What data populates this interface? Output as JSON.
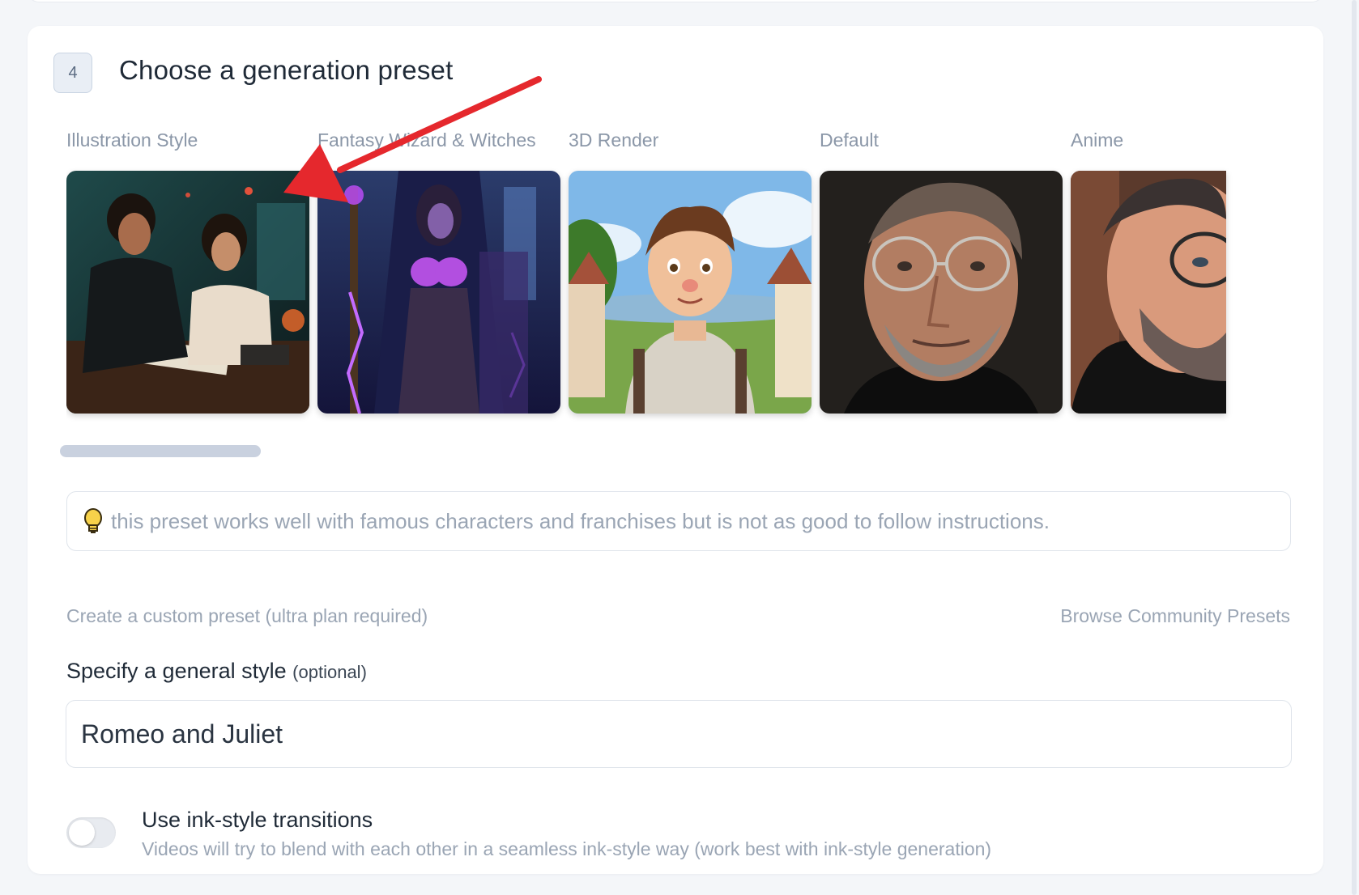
{
  "step": {
    "number": "4",
    "title": "Choose a generation preset"
  },
  "presets": [
    {
      "label": "Illustration Style",
      "image": "two people at a desk in a dark workshop"
    },
    {
      "label": "Fantasy Wizard & Witches",
      "image": "hooded witch with purple glowing staff"
    },
    {
      "label": "3D Render",
      "image": "cartoon 3D boy in hoodie in village"
    },
    {
      "label": "Default",
      "image": "photo portrait of man with round glasses"
    },
    {
      "label": "Anime",
      "image": "painted portrait of man with glasses"
    }
  ],
  "tip": {
    "icon": "lightbulb-icon",
    "text": "this preset works well with famous characters and franchises but is not as good to follow instructions."
  },
  "links": {
    "custom_preset": "Create a custom preset (ultra plan required)",
    "community_presets": "Browse Community Presets"
  },
  "general_style": {
    "label": "Specify a general style",
    "optional": "(optional)",
    "value": "Romeo and Juliet"
  },
  "ink_transitions": {
    "title": "Use ink-style transitions",
    "description": "Videos will try to blend with each other in a seamless ink-style way (work best with ink-style generation)",
    "enabled": false
  },
  "colors": {
    "annotation_arrow": "#e5282d",
    "text_muted": "#9aa5b4",
    "text_dark": "#1f2a37"
  }
}
